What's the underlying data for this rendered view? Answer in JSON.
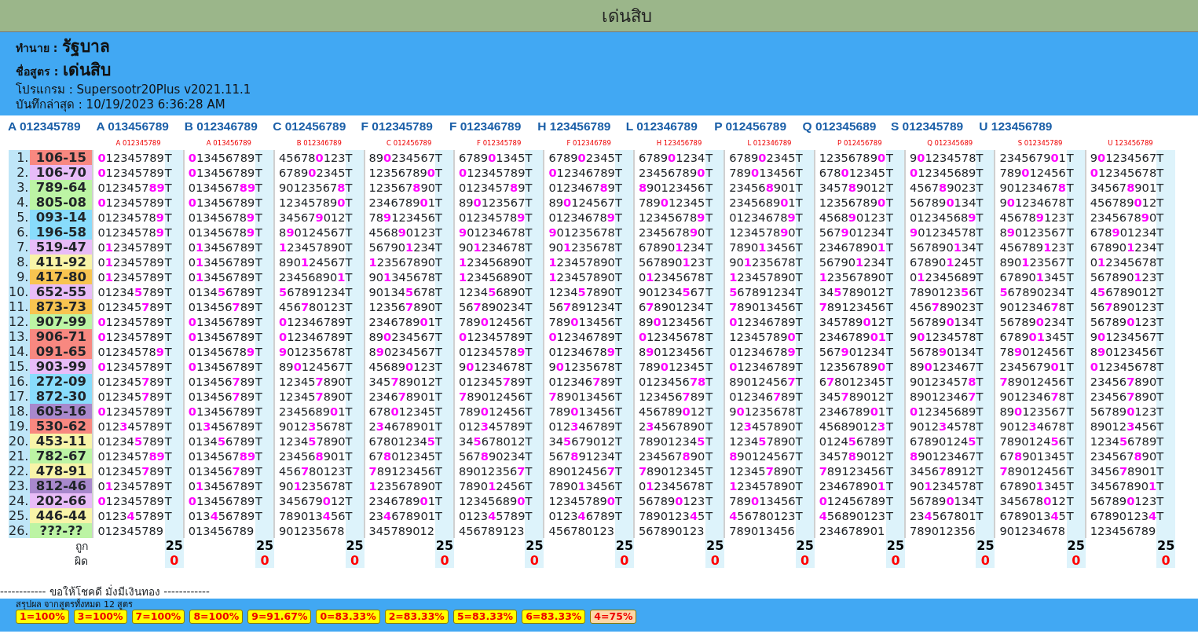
{
  "title": "เด่นสิบ",
  "info": [
    {
      "label": "ทำนาย :",
      "value": "รัฐบาล",
      "kind": "big"
    },
    {
      "label": "ชื่อสูตร :",
      "value": "เด่นสิบ",
      "kind": "big"
    },
    {
      "label": "โปรแกรม :",
      "value": "Supersootr20Plus v2021.11.1",
      "kind": "plain"
    },
    {
      "label": "บันทึกล่าสุด :",
      "value": "10/19/2023 6:36:28 AM",
      "kind": "plain"
    }
  ],
  "formulas": [
    "A 012345789",
    "A 013456789",
    "B 012346789",
    "C 012456789",
    "F 012345789",
    "F 012346789",
    "H 123456789",
    "L 012346789",
    "P 012456789",
    "Q 012345689",
    "S 012345789",
    "U 123456789"
  ],
  "table": {
    "columns": [
      "A 012345789",
      "A 013456789",
      "B 012346789",
      "C 012456789",
      "F 012345789",
      "F 012346789",
      "H 123456789",
      "L 012346789",
      "P 012456789",
      "Q 012345689",
      "S 012345789",
      "U 123456789"
    ],
    "rows": [
      {
        "number": "1.",
        "result": "106-15",
        "color": "#f88880",
        "cells": [
          {
            "digits": "**0**12345789",
            "mark": "T"
          },
          {
            "digits": "**0**13456789",
            "mark": "T"
          },
          {
            "digits": "45678**0**123",
            "mark": "T"
          },
          {
            "digits": "89**0**234567",
            "mark": "T"
          },
          {
            "digits": "6789**0**1345",
            "mark": "T"
          },
          {
            "digits": "6789**0**2345",
            "mark": "T"
          },
          {
            "digits": "6789**0**1234",
            "mark": "T"
          },
          {
            "digits": "6789**0**2345",
            "mark": "T"
          },
          {
            "digits": "12356789**0**",
            "mark": "T"
          },
          {
            "digits": "9**0**1234578",
            "mark": "T"
          },
          {
            "digits": "2345679**0**1",
            "mark": "T"
          },
          {
            "digits": "9**0**1234567",
            "mark": "T"
          }
        ]
      },
      {
        "number": "2.",
        "result": "106-70",
        "color": "#e8bcf8",
        "cells": [
          {
            "digits": "**0**12345789",
            "mark": "T"
          },
          {
            "digits": "**0**13456789",
            "mark": "T"
          },
          {
            "digits": "6789**0**2345",
            "mark": "T"
          },
          {
            "digits": "12356789**0**",
            "mark": "T"
          },
          {
            "digits": "**0**12345789",
            "mark": "T"
          },
          {
            "digits": "**0**12346789",
            "mark": "T"
          },
          {
            "digits": "23456789**0**",
            "mark": "T"
          },
          {
            "digits": "789**0**13456",
            "mark": "T"
          },
          {
            "digits": "678**0**12345",
            "mark": "T"
          },
          {
            "digits": "**0**12345689",
            "mark": "T"
          },
          {
            "digits": "789**0**12456",
            "mark": "T"
          },
          {
            "digits": "**0**12345678",
            "mark": "T"
          }
        ]
      },
      {
        "number": "3.",
        "result": "789-64",
        "color": "#bcf4a4",
        "cells": [
          {
            "digits": "0123457**89**",
            "mark": "T"
          },
          {
            "digits": "0134567**89**",
            "mark": "T"
          },
          {
            "digits": "90123567**8**",
            "mark": "T"
          },
          {
            "digits": "123567**8**90",
            "mark": "T"
          },
          {
            "digits": "0123457**8**9",
            "mark": "T"
          },
          {
            "digits": "0123467**8**9",
            "mark": "T"
          },
          {
            "digits": "**8**90123456",
            "mark": "T"
          },
          {
            "digits": "23456**8**901",
            "mark": "T"
          },
          {
            "digits": "3457**8**9012",
            "mark": "T"
          },
          {
            "digits": "4567**8**9023",
            "mark": "T"
          },
          {
            "digits": "90123467**8**",
            "mark": "T"
          },
          {
            "digits": "34567**8**901",
            "mark": "T"
          }
        ]
      },
      {
        "number": "4.",
        "result": "805-08",
        "color": "#bcf4a4",
        "cells": [
          {
            "digits": "**0**12345789",
            "mark": "T"
          },
          {
            "digits": "**0**13456789",
            "mark": "T"
          },
          {
            "digits": "12345789**0**",
            "mark": "T"
          },
          {
            "digits": "2346789**0**1",
            "mark": "T"
          },
          {
            "digits": "89**0**123567",
            "mark": "T"
          },
          {
            "digits": "89**0**124567",
            "mark": "T"
          },
          {
            "digits": "789**0**12345",
            "mark": "T"
          },
          {
            "digits": "2345689**0**1",
            "mark": "T"
          },
          {
            "digits": "12356789**0**",
            "mark": "T"
          },
          {
            "digits": "56789**0**134",
            "mark": "T"
          },
          {
            "digits": "9**0**1234678",
            "mark": "T"
          },
          {
            "digits": "456789**0**12",
            "mark": "T"
          }
        ]
      },
      {
        "number": "5.",
        "result": "093-14",
        "color": "#88dcfc",
        "cells": [
          {
            "digits": "01234578**9**",
            "mark": "T"
          },
          {
            "digits": "01345678**9**",
            "mark": "T"
          },
          {
            "digits": "34567**9**012",
            "mark": "T"
          },
          {
            "digits": "78**9**123456",
            "mark": "T"
          },
          {
            "digits": "01234578**9**",
            "mark": "T"
          },
          {
            "digits": "01234678**9**",
            "mark": "T"
          },
          {
            "digits": "12345678**9**",
            "mark": "T"
          },
          {
            "digits": "01234678**9**",
            "mark": "T"
          },
          {
            "digits": "4568**9**0123",
            "mark": "T"
          },
          {
            "digits": "01234568**9**",
            "mark": "T"
          },
          {
            "digits": "45678**9**123",
            "mark": "T"
          },
          {
            "digits": "2345678**9**0",
            "mark": "T"
          }
        ]
      },
      {
        "number": "6.",
        "result": "196-58",
        "color": "#88dcfc",
        "cells": [
          {
            "digits": "01234578**9**",
            "mark": "T"
          },
          {
            "digits": "01345678**9**",
            "mark": "T"
          },
          {
            "digits": "8**9**0124567",
            "mark": "T"
          },
          {
            "digits": "4568**9**0123",
            "mark": "T"
          },
          {
            "digits": "**9**01234678",
            "mark": "T"
          },
          {
            "digits": "**9**01235678",
            "mark": "T"
          },
          {
            "digits": "2345678**9**0",
            "mark": "T"
          },
          {
            "digits": "1234578**9**0",
            "mark": "T"
          },
          {
            "digits": "567**9**01234",
            "mark": "T"
          },
          {
            "digits": "**9**01234578",
            "mark": "T"
          },
          {
            "digits": "8**9**0123567",
            "mark": "T"
          },
          {
            "digits": "678**9**01234",
            "mark": "T"
          }
        ]
      },
      {
        "number": "7.",
        "result": "519-47",
        "color": "#e8bcf8",
        "cells": [
          {
            "digits": "0**1**2345789",
            "mark": "T"
          },
          {
            "digits": "0**1**3456789",
            "mark": "T"
          },
          {
            "digits": "**1**23457890",
            "mark": "T"
          },
          {
            "digits": "56790**1**234",
            "mark": "T"
          },
          {
            "digits": "90**1**234678",
            "mark": "T"
          },
          {
            "digits": "90**1**235678",
            "mark": "T"
          },
          {
            "digits": "67890**1**234",
            "mark": "T"
          },
          {
            "digits": "7890**1**3456",
            "mark": "T"
          },
          {
            "digits": "23467890**1**",
            "mark": "T"
          },
          {
            "digits": "567890**1**34",
            "mark": "T"
          },
          {
            "digits": "456789**1**23",
            "mark": "T"
          },
          {
            "digits": "67890**1**234",
            "mark": "T"
          }
        ]
      },
      {
        "number": "8.",
        "result": "411-92",
        "color": "#f8f4a8",
        "cells": [
          {
            "digits": "0**1**2345789",
            "mark": "T"
          },
          {
            "digits": "0**1**3456789",
            "mark": "T"
          },
          {
            "digits": "890**1**24567",
            "mark": "T"
          },
          {
            "digits": "**1**23567890",
            "mark": "T"
          },
          {
            "digits": "**1**23456890",
            "mark": "T"
          },
          {
            "digits": "**1**23457890",
            "mark": "T"
          },
          {
            "digits": "567890**1**23",
            "mark": "T"
          },
          {
            "digits": "90**1**235678",
            "mark": "T"
          },
          {
            "digits": "56790**1**234",
            "mark": "T"
          },
          {
            "digits": "67890**1**245",
            "mark": "T"
          },
          {
            "digits": "890**1**23567",
            "mark": "T"
          },
          {
            "digits": "0**1**2345678",
            "mark": "T"
          }
        ]
      },
      {
        "number": "9.",
        "result": "417-80",
        "color": "#f8c450",
        "cells": [
          {
            "digits": "0**1**2345789",
            "mark": "T"
          },
          {
            "digits": "0**1**3456789",
            "mark": "T"
          },
          {
            "digits": "23456890**1**",
            "mark": "T"
          },
          {
            "digits": "90**1**345678",
            "mark": "T"
          },
          {
            "digits": "**1**23456890",
            "mark": "T"
          },
          {
            "digits": "**1**23457890",
            "mark": "T"
          },
          {
            "digits": "0**1**2345678",
            "mark": "T"
          },
          {
            "digits": "**1**23457890",
            "mark": "T"
          },
          {
            "digits": "**1**23567890",
            "mark": "T"
          },
          {
            "digits": "0**1**2345689",
            "mark": "T"
          },
          {
            "digits": "67890**1**345",
            "mark": "T"
          },
          {
            "digits": "567890**1**23",
            "mark": "T"
          }
        ]
      },
      {
        "number": "10.",
        "result": "652-55",
        "color": "#e8bcf8",
        "cells": [
          {
            "digits": "01234**5**789",
            "mark": "T"
          },
          {
            "digits": "0134**5**6789",
            "mark": "T"
          },
          {
            "digits": "**5**67891234",
            "mark": "T"
          },
          {
            "digits": "90134**5**678",
            "mark": "T"
          },
          {
            "digits": "1234**5**6890",
            "mark": "T"
          },
          {
            "digits": "1234**5**7890",
            "mark": "T"
          },
          {
            "digits": "901234**5**67",
            "mark": "T"
          },
          {
            "digits": "**5**67891234",
            "mark": "T"
          },
          {
            "digits": "34**5**789012",
            "mark": "T"
          },
          {
            "digits": "7890123**5**6",
            "mark": "T"
          },
          {
            "digits": "**5**67890234",
            "mark": "T"
          },
          {
            "digits": "4**5**6789012",
            "mark": "T"
          }
        ]
      },
      {
        "number": "11.",
        "result": "873-73",
        "color": "#f8c450",
        "cells": [
          {
            "digits": "012345**7**89",
            "mark": "T"
          },
          {
            "digits": "013456**7**89",
            "mark": "T"
          },
          {
            "digits": "456**7**80123",
            "mark": "T"
          },
          {
            "digits": "12356**7**890",
            "mark": "T"
          },
          {
            "digits": "56**7**890234",
            "mark": "T"
          },
          {
            "digits": "56**7**891234",
            "mark": "T"
          },
          {
            "digits": "6**7**8901234",
            "mark": "T"
          },
          {
            "digits": "**7**89013456",
            "mark": "T"
          },
          {
            "digits": "**7**89123456",
            "mark": "T"
          },
          {
            "digits": "456**7**89023",
            "mark": "T"
          },
          {
            "digits": "9012346**7**8",
            "mark": "T"
          },
          {
            "digits": "56**7**890123",
            "mark": "T"
          }
        ]
      },
      {
        "number": "12.",
        "result": "907-99",
        "color": "#bcf4a4",
        "cells": [
          {
            "digits": "**0**12345789",
            "mark": "T"
          },
          {
            "digits": "**0**13456789",
            "mark": "T"
          },
          {
            "digits": "**0**12346789",
            "mark": "T"
          },
          {
            "digits": "2346789**0**1",
            "mark": "T"
          },
          {
            "digits": "789**0**12456",
            "mark": "T"
          },
          {
            "digits": "789**0**13456",
            "mark": "T"
          },
          {
            "digits": "89**0**123456",
            "mark": "T"
          },
          {
            "digits": "**0**12346789",
            "mark": "T"
          },
          {
            "digits": "345789**0**12",
            "mark": "T"
          },
          {
            "digits": "56789**0**134",
            "mark": "T"
          },
          {
            "digits": "56789**0**234",
            "mark": "T"
          },
          {
            "digits": "56789**0**123",
            "mark": "T"
          }
        ]
      },
      {
        "number": "13.",
        "result": "906-71",
        "color": "#f88880",
        "cells": [
          {
            "digits": "**0**12345789",
            "mark": "T"
          },
          {
            "digits": "**0**13456789",
            "mark": "T"
          },
          {
            "digits": "**0**12346789",
            "mark": "T"
          },
          {
            "digits": "89**0**234567",
            "mark": "T"
          },
          {
            "digits": "**0**12345789",
            "mark": "T"
          },
          {
            "digits": "**0**12346789",
            "mark": "T"
          },
          {
            "digits": "**0**12345678",
            "mark": "T"
          },
          {
            "digits": "12345789**0**",
            "mark": "T"
          },
          {
            "digits": "2346789**01**",
            "mark": "T"
          },
          {
            "digits": "9**0**1234578",
            "mark": "T"
          },
          {
            "digits": "6789**01**345",
            "mark": "T"
          },
          {
            "digits": "9**0**1234567",
            "mark": "T"
          }
        ]
      },
      {
        "number": "14.",
        "result": "091-65",
        "color": "#f88880",
        "cells": [
          {
            "digits": "01234578**9**",
            "mark": "T"
          },
          {
            "digits": "01345678**9**",
            "mark": "T"
          },
          {
            "digits": "**9**01235678",
            "mark": "T"
          },
          {
            "digits": "8**9**0234567",
            "mark": "T"
          },
          {
            "digits": "01234578**9**",
            "mark": "T"
          },
          {
            "digits": "01234678**9**",
            "mark": "T"
          },
          {
            "digits": "8**9**0123456",
            "mark": "T"
          },
          {
            "digits": "01234678**9**",
            "mark": "T"
          },
          {
            "digits": "567**9**01234",
            "mark": "T"
          },
          {
            "digits": "5678**9**0134",
            "mark": "T"
          },
          {
            "digits": "78**9**012456",
            "mark": "T"
          },
          {
            "digits": "8**9**0123456",
            "mark": "T"
          }
        ]
      },
      {
        "number": "15.",
        "result": "903-99",
        "color": "#e8bcf8",
        "cells": [
          {
            "digits": "**0**12345789",
            "mark": "T"
          },
          {
            "digits": "**0**13456789",
            "mark": "T"
          },
          {
            "digits": "89**0**124567",
            "mark": "T"
          },
          {
            "digits": "45689**0**123",
            "mark": "T"
          },
          {
            "digits": "9**0**1234678",
            "mark": "T"
          },
          {
            "digits": "9**0**1235678",
            "mark": "T"
          },
          {
            "digits": "789**0**12345",
            "mark": "T"
          },
          {
            "digits": "**0**12346789",
            "mark": "T"
          },
          {
            "digits": "12356789**0**",
            "mark": "T"
          },
          {
            "digits": "89**0**123467",
            "mark": "T"
          },
          {
            "digits": "2345679**0**1",
            "mark": "T"
          },
          {
            "digits": "**0**12345678",
            "mark": "T"
          }
        ]
      },
      {
        "number": "16.",
        "result": "272-09",
        "color": "#88dcfc",
        "cells": [
          {
            "digits": "012345**7**89",
            "mark": "T"
          },
          {
            "digits": "013456**7**89",
            "mark": "T"
          },
          {
            "digits": "12345**7**890",
            "mark": "T"
          },
          {
            "digits": "345**7**89012",
            "mark": "T"
          },
          {
            "digits": "012345**7**89",
            "mark": "T"
          },
          {
            "digits": "012346**7**89",
            "mark": "T"
          },
          {
            "digits": "0123456**78**",
            "mark": "T"
          },
          {
            "digits": "89012456**7**",
            "mark": "T"
          },
          {
            "digits": "6**7**8012345",
            "mark": "T"
          },
          {
            "digits": "90123457**8**",
            "mark": "T"
          },
          {
            "digits": "**7**89012456",
            "mark": "T"
          },
          {
            "digits": "23456**7**890",
            "mark": "T"
          }
        ]
      },
      {
        "number": "17.",
        "result": "872-30",
        "color": "#88dcfc",
        "cells": [
          {
            "digits": "012345**7**89",
            "mark": "T"
          },
          {
            "digits": "013456**7**89",
            "mark": "T"
          },
          {
            "digits": "12345**7**890",
            "mark": "T"
          },
          {
            "digits": "2346**7**8901",
            "mark": "T"
          },
          {
            "digits": "**7**89012456",
            "mark": "T"
          },
          {
            "digits": "**7**89013456",
            "mark": "T"
          },
          {
            "digits": "123456**7**89",
            "mark": "T"
          },
          {
            "digits": "012346**7**89",
            "mark": "T"
          },
          {
            "digits": "345**7**89012",
            "mark": "T"
          },
          {
            "digits": "89012346**7**",
            "mark": "T"
          },
          {
            "digits": "9012346**7**8",
            "mark": "T"
          },
          {
            "digits": "23456**7**890",
            "mark": "T"
          }
        ]
      },
      {
        "number": "18.",
        "result": "605-16",
        "color": "#a888cc",
        "cells": [
          {
            "digits": "**0**12345789",
            "mark": "T"
          },
          {
            "digits": "**0**13456789",
            "mark": "T"
          },
          {
            "digits": "2345689**0**1",
            "mark": "T"
          },
          {
            "digits": "678**0**12345",
            "mark": "T"
          },
          {
            "digits": "789**0**12456",
            "mark": "T"
          },
          {
            "digits": "789**0**13456",
            "mark": "T"
          },
          {
            "digits": "456789**0**12",
            "mark": "T"
          },
          {
            "digits": "9**0**1235678",
            "mark": "T"
          },
          {
            "digits": "2346789**0**1",
            "mark": "T"
          },
          {
            "digits": "**0**12345689",
            "mark": "T"
          },
          {
            "digits": "89**0**123567",
            "mark": "T"
          },
          {
            "digits": "56789**0**123",
            "mark": "T"
          }
        ]
      },
      {
        "number": "19.",
        "result": "530-62",
        "color": "#f88880",
        "cells": [
          {
            "digits": "012**3**45789",
            "mark": "T"
          },
          {
            "digits": "01**3**456789",
            "mark": "T"
          },
          {
            "digits": "9012**3**5678",
            "mark": "T"
          },
          {
            "digits": "2**3**4678901",
            "mark": "T"
          },
          {
            "digits": "012**3**45789",
            "mark": "T"
          },
          {
            "digits": "012**3**46789",
            "mark": "T"
          },
          {
            "digits": "2**3**4567890",
            "mark": "T"
          },
          {
            "digits": "12**3**457890",
            "mark": "T"
          },
          {
            "digits": "45689012**3**",
            "mark": "T"
          },
          {
            "digits": "9012**3**4578",
            "mark": "T"
          },
          {
            "digits": "9012**3**4678",
            "mark": "T"
          },
          {
            "digits": "89012**3**456",
            "mark": "T"
          }
        ]
      },
      {
        "number": "20.",
        "result": "453-11",
        "color": "#f8f4a8",
        "cells": [
          {
            "digits": "01234**5**789",
            "mark": "T"
          },
          {
            "digits": "0134**5**6789",
            "mark": "T"
          },
          {
            "digits": "1234**5**7890",
            "mark": "T"
          },
          {
            "digits": "67801234**5**",
            "mark": "T"
          },
          {
            "digits": "34**5**678012",
            "mark": "T"
          },
          {
            "digits": "34**5**679012",
            "mark": "T"
          },
          {
            "digits": "78901234**5**",
            "mark": "T"
          },
          {
            "digits": "1234**5**7890",
            "mark": "T"
          },
          {
            "digits": "0124**5**6789",
            "mark": "T"
          },
          {
            "digits": "67890124**5**",
            "mark": "T"
          },
          {
            "digits": "7890124**5**6",
            "mark": "T"
          },
          {
            "digits": "1234**5**6789",
            "mark": "T"
          }
        ]
      },
      {
        "number": "21.",
        "result": "782-67",
        "color": "#bcf4a4",
        "cells": [
          {
            "digits": "0123457**89**",
            "mark": "T"
          },
          {
            "digits": "0134567**89**",
            "mark": "T"
          },
          {
            "digits": "23456**8**901",
            "mark": "T"
          },
          {
            "digits": "67**8**012345",
            "mark": "T"
          },
          {
            "digits": "567**8**90234",
            "mark": "T"
          },
          {
            "digits": "567**8**91234",
            "mark": "T"
          },
          {
            "digits": "234567**8**90",
            "mark": "T"
          },
          {
            "digits": "**8**90124567",
            "mark": "T"
          },
          {
            "digits": "3457**8**9012",
            "mark": "T"
          },
          {
            "digits": "**8**90123467",
            "mark": "T"
          },
          {
            "digits": "67**8**901345",
            "mark": "T"
          },
          {
            "digits": "234567**8**90",
            "mark": "T"
          }
        ]
      },
      {
        "number": "22.",
        "result": "478-91",
        "color": "#f8f4a8",
        "cells": [
          {
            "digits": "012345**7**89",
            "mark": "T"
          },
          {
            "digits": "013456**7**89",
            "mark": "T"
          },
          {
            "digits": "456**7**80123",
            "mark": "T"
          },
          {
            "digits": "**7**89123456",
            "mark": "T"
          },
          {
            "digits": "89012356**7**",
            "mark": "T"
          },
          {
            "digits": "89012456**7**",
            "mark": "T"
          },
          {
            "digits": "**7**89012345",
            "mark": "T"
          },
          {
            "digits": "12345**7**890",
            "mark": "T"
          },
          {
            "digits": "**7**89123456",
            "mark": "T"
          },
          {
            "digits": "3456**7**8912",
            "mark": "T"
          },
          {
            "digits": "**7**89012456",
            "mark": "T"
          },
          {
            "digits": "3456**7**8901",
            "mark": "T"
          }
        ]
      },
      {
        "number": "23.",
        "result": "812-46",
        "color": "#a888cc",
        "cells": [
          {
            "digits": "0**1**2345789",
            "mark": "T"
          },
          {
            "digits": "0**1**3456789",
            "mark": "T"
          },
          {
            "digits": "90**1**235678",
            "mark": "T"
          },
          {
            "digits": "**1**23567890",
            "mark": "T"
          },
          {
            "digits": "7890**1**2456",
            "mark": "T"
          },
          {
            "digits": "7890**1**3456",
            "mark": "T"
          },
          {
            "digits": "0**1**2345678",
            "mark": "T"
          },
          {
            "digits": "**1**23457890",
            "mark": "T"
          },
          {
            "digits": "23467890**1**",
            "mark": "T"
          },
          {
            "digits": "90**1**234578",
            "mark": "T"
          },
          {
            "digits": "67890**1**345",
            "mark": "T"
          },
          {
            "digits": "34567890**1**",
            "mark": "T"
          }
        ]
      },
      {
        "number": "24.",
        "result": "202-66",
        "color": "#e8bcf8",
        "cells": [
          {
            "digits": "**0**12345789",
            "mark": "T"
          },
          {
            "digits": "**0**13456789",
            "mark": "T"
          },
          {
            "digits": "345679**0**12",
            "mark": "T"
          },
          {
            "digits": "2346789**0**1",
            "mark": "T"
          },
          {
            "digits": "12345689**0**",
            "mark": "T"
          },
          {
            "digits": "12345789**0**",
            "mark": "T"
          },
          {
            "digits": "56789**0**123",
            "mark": "T"
          },
          {
            "digits": "789**0**13456",
            "mark": "T"
          },
          {
            "digits": "**0**12456789",
            "mark": "T"
          },
          {
            "digits": "56789**0**134",
            "mark": "T"
          },
          {
            "digits": "345678**0**12",
            "mark": "T"
          },
          {
            "digits": "56789**0**123",
            "mark": "T"
          }
        ]
      },
      {
        "number": "25.",
        "result": "446-44",
        "color": "#f8f4a8",
        "cells": [
          {
            "digits": "0123**4**5789",
            "mark": "T"
          },
          {
            "digits": "013**4**56789",
            "mark": "T"
          },
          {
            "digits": "789013**4**56",
            "mark": "T"
          },
          {
            "digits": "23**4**678901",
            "mark": "T"
          },
          {
            "digits": "0123**4**5789",
            "mark": "T"
          },
          {
            "digits": "0123**4**6789",
            "mark": "T"
          },
          {
            "digits": "7890123**4**5",
            "mark": "T"
          },
          {
            "digits": "**4**56780123",
            "mark": "T"
          },
          {
            "digits": "**4**56890123",
            "mark": "T"
          },
          {
            "digits": "23**4**567801",
            "mark": "T"
          },
          {
            "digits": "6789013**4**5",
            "mark": "T"
          },
          {
            "digits": "67890123**4**",
            "mark": "T"
          }
        ]
      },
      {
        "number": "26.",
        "result": "???-??",
        "color": "#bcf4a4",
        "cells": [
          {
            "digits": "012345789"
          },
          {
            "digits": "013456789"
          },
          {
            "digits": "901235678"
          },
          {
            "digits": "345789012"
          },
          {
            "digits": "456789123"
          },
          {
            "digits": "456780123"
          },
          {
            "digits": "567890123"
          },
          {
            "digits": "789013456"
          },
          {
            "digits": "234678901"
          },
          {
            "digits": "789012356"
          },
          {
            "digits": "901234678"
          },
          {
            "digits": "123456789"
          }
        ]
      }
    ],
    "totals": [
      {
        "label": "ถูก",
        "kind": "correct",
        "values": [
          "25",
          "25",
          "25",
          "25",
          "25",
          "25",
          "25",
          "25",
          "25",
          "25",
          "25",
          "25"
        ]
      },
      {
        "label": "ผิด",
        "kind": "wrong",
        "values": [
          "0",
          "0",
          "0",
          "0",
          "0",
          "0",
          "0",
          "0",
          "0",
          "0",
          "0",
          "0"
        ]
      }
    ]
  },
  "closing": "------------ ขอให้โชคดี มั่งมีเงินทอง ------------",
  "summary": {
    "caption": "สรุปผล จากสูตรทั้งหมด 12 สูตร",
    "badges": [
      {
        "text": "1=100%",
        "color": "#ffff00"
      },
      {
        "text": "3=100%",
        "color": "#ffff00"
      },
      {
        "text": "7=100%",
        "color": "#ffff00"
      },
      {
        "text": "8=100%",
        "color": "#ffff00"
      },
      {
        "text": "9=91.67%",
        "color": "#ffff00"
      },
      {
        "text": "0=83.33%",
        "color": "#ffff00"
      },
      {
        "text": "2=83.33%",
        "color": "#ffff00"
      },
      {
        "text": "5=83.33%",
        "color": "#ffff00"
      },
      {
        "text": "6=83.33%",
        "color": "#ffff00"
      },
      {
        "text": "4=75%",
        "color": "#fcd8a8"
      }
    ]
  }
}
